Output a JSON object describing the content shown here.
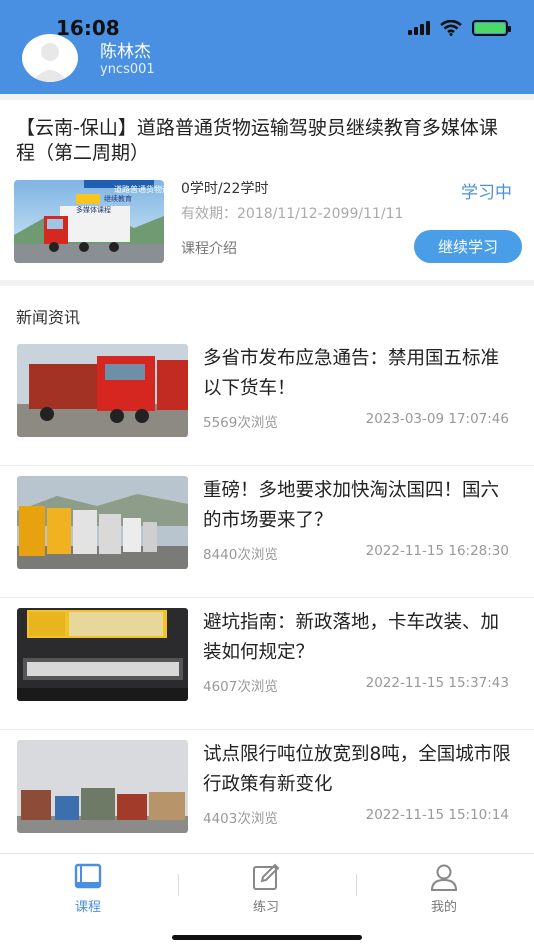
{
  "status_bar": {
    "time": "16:08"
  },
  "user": {
    "name": "陈林杰",
    "id": "yncs001"
  },
  "course": {
    "title": "【云南-保山】道路普通货物运输驾驶员继续教育多媒体课程（第二周期）",
    "hours": "0学时/22学时",
    "validity": "有效期：2018/11/12-2099/11/11",
    "intro": "课程介绍",
    "status": "学习中",
    "continue_label": "继续学习",
    "thumb_text": {
      "line1": "道路普通货物运输",
      "line2": "继续教育",
      "line3": "多媒体课程"
    }
  },
  "news": {
    "title": "新闻资讯",
    "items": [
      {
        "title": "多省市发布应急通告：禁用国五标准以下货车！",
        "views": "5569次浏览",
        "date": "2023-03-09 17:07:46"
      },
      {
        "title": "重磅！多地要求加快淘汰国四！国六的市场要来了？",
        "views": "8440次浏览",
        "date": "2022-11-15 16:28:30"
      },
      {
        "title": "避坑指南：新政落地，卡车改装、加装如何规定？",
        "views": "4607次浏览",
        "date": "2022-11-15 15:37:43"
      },
      {
        "title": "试点限行吨位放宽到8吨，全国城市限行政策有新变化",
        "views": "4403次浏览",
        "date": "2022-11-15 15:10:14"
      }
    ]
  },
  "tabs": [
    {
      "label": "课程",
      "icon": "book-icon",
      "active": true
    },
    {
      "label": "练习",
      "icon": "edit-icon",
      "active": false
    },
    {
      "label": "我的",
      "icon": "user-icon",
      "active": false
    }
  ],
  "colors": {
    "primary": "#4a90e2",
    "button": "#4a9ee8"
  }
}
